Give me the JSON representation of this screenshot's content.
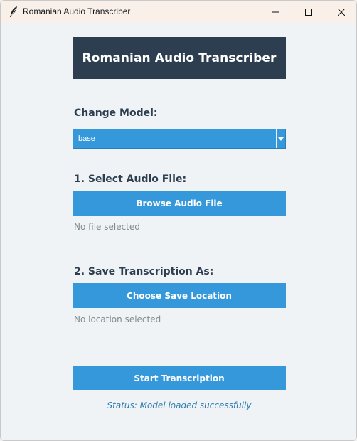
{
  "window": {
    "title": "Romanian Audio Transcriber",
    "icon": "feather-icon",
    "controls": [
      "minimize-icon",
      "maximize-icon",
      "close-icon"
    ],
    "titlebar_color": "#f9f0ea"
  },
  "header": {
    "title": "Romanian Audio Transcriber",
    "background": "#2c3e50"
  },
  "model": {
    "label": "Change Model:",
    "selected": "base"
  },
  "audio": {
    "label": "1. Select Audio File:",
    "button": "Browse Audio File",
    "hint": "No file selected"
  },
  "save": {
    "label": "2. Save Transcription As:",
    "button": "Choose Save Location",
    "hint": "No location selected"
  },
  "actions": {
    "start": "Start Transcription"
  },
  "status": {
    "text": "Status: Model loaded successfully"
  },
  "colors": {
    "accent": "#3498db",
    "dark": "#2c3e50",
    "muted": "#7f8c8d",
    "status": "#2f7dae"
  }
}
